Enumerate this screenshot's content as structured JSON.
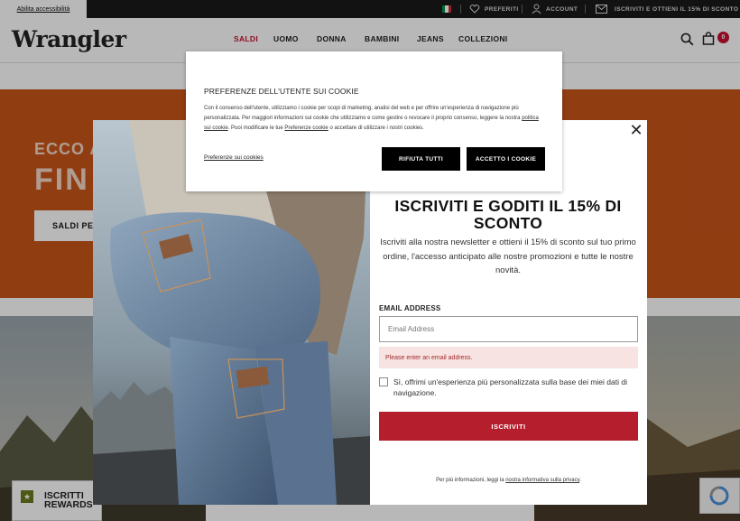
{
  "colors": {
    "brand_red": "#c8102e",
    "hero_orange": "#c9551a",
    "submit_red": "#b51f2d",
    "rewards_green": "#6b7a1e"
  },
  "topbar": {
    "accessibility_link": "Abilita accessibilità",
    "favorites": "PREFERITI",
    "account": "ACCOUNT",
    "subscribe": "ISCRIVITI E OTTIENI IL 15% DI SCONTO"
  },
  "header": {
    "logo": "Wrangler",
    "nav": [
      "SALDI",
      "UOMO",
      "DONNA",
      "BAMBINI",
      "JEANS",
      "COLLEZIONI"
    ],
    "cart_count": "0",
    "icons": {
      "search": "search-icon",
      "cart": "bag-icon",
      "favorites": "heart-icon",
      "account": "user-icon",
      "mail": "mail-icon"
    }
  },
  "hero": {
    "line1": "ECCO A",
    "line2": "FIN",
    "button": "SALDI PE"
  },
  "rewards": {
    "line1": "ISCRITTI",
    "line2": "REWARDS"
  },
  "newsletter": {
    "close": "✕",
    "title": "ISCRIVITI E GODITI IL 15% DI SCONTO",
    "description": "Iscriviti alla nostra newsletter e ottieni il 15% di sconto sul tuo primo ordine, l'accesso anticipato alle nostre promozioni e tutte le nostre novità.",
    "email_label": "EMAIL ADDRESS",
    "email_placeholder": "Email Address",
    "email_value": "",
    "error": "Please enter an email address.",
    "opt_in": "Sì, offrimi un'esperienza più personalizzata sulla base dei miei dati di navigazione.",
    "submit": "ISCRIVITI",
    "privacy_prefix": "Per più informazioni, leggi la",
    "privacy_link": "nostra informativa sulla privacy"
  },
  "cookie": {
    "title": "PREFERENZE DELL'UTENTE SUI COOKIE",
    "text_1": "Con il consenso dell'utente, utilizziamo i cookie per scopi di marketing, analisi del web e per offrire un'esperienza di navigazione più personalizzata. Per maggiori informazioni sui cookie che utilizziamo e come gestire o revocare il proprio consenso, leggere la nostra",
    "link_policy": "politica sui cookie",
    "text_2": ". Puoi modificare le tue",
    "link_prefs": "Preferenze cookie",
    "text_3": "o accettare di utilizzare i nostri cookies.",
    "preferences": "Preferenze sui cookies",
    "reject": "RIFIUTA TUTTI",
    "accept": "ACCETTO I COOKIE"
  }
}
